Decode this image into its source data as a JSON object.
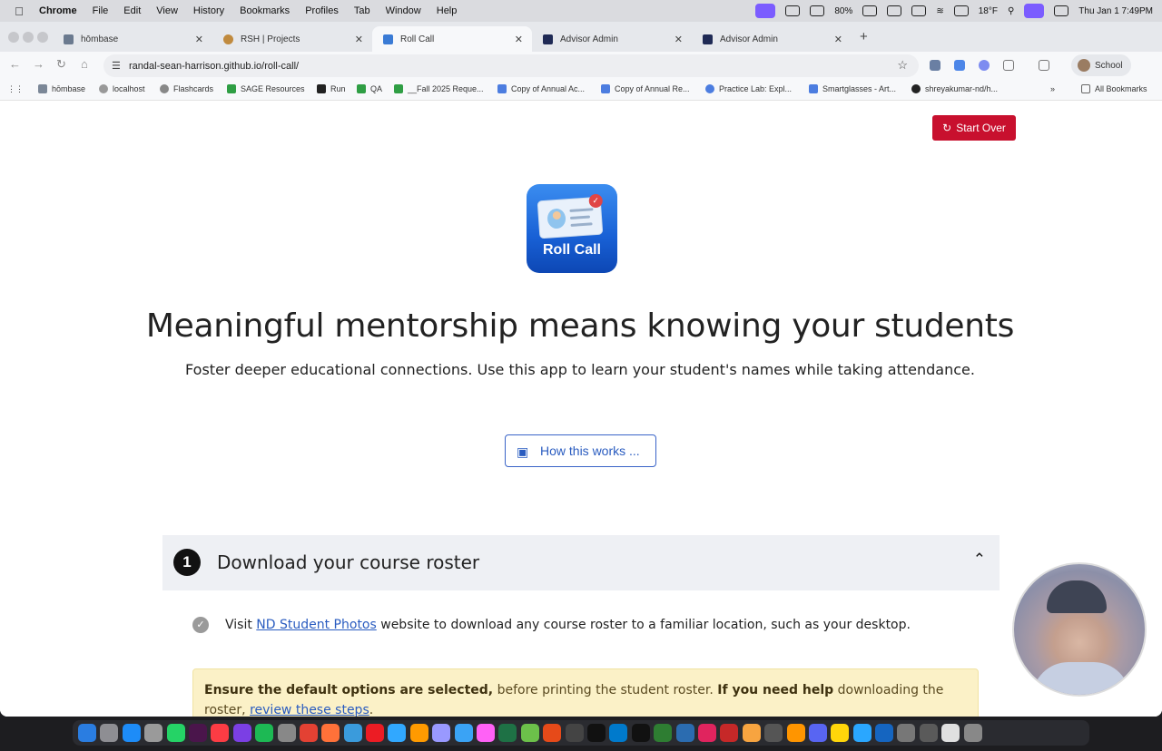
{
  "menubar": {
    "items": [
      "Chrome",
      "File",
      "Edit",
      "View",
      "History",
      "Bookmarks",
      "Profiles",
      "Tab",
      "Window",
      "Help"
    ],
    "battery": "80%",
    "weather": "18°F",
    "clock": "Thu Jan 1  7:49PM"
  },
  "tabs": [
    {
      "title": "hōmbase",
      "active": false,
      "color": "#6b7a8f"
    },
    {
      "title": "RSH | Projects",
      "active": false,
      "color": "#c08a3e"
    },
    {
      "title": "Roll Call",
      "active": true,
      "color": "#3a7bd5"
    },
    {
      "title": "Advisor Admin",
      "active": false,
      "color": "#1f2a55"
    },
    {
      "title": "Advisor Admin",
      "active": false,
      "color": "#1f2a55"
    }
  ],
  "toolbar": {
    "url": "randal-sean-harrison.github.io/roll-call/",
    "profile_label": "School"
  },
  "bookmarks": [
    {
      "label": "hōmbase",
      "color": "#7b8797"
    },
    {
      "label": "localhost",
      "color": "#999"
    },
    {
      "label": "Flashcards",
      "color": "#888"
    },
    {
      "label": "SAGE Resources",
      "color": "#2f9e44"
    },
    {
      "label": "Run",
      "color": "#222"
    },
    {
      "label": "QA",
      "color": "#2f9e44"
    },
    {
      "label": "__Fall 2025 Reque...",
      "color": "#2f9e44"
    },
    {
      "label": "Copy of Annual Ac...",
      "color": "#4c7de0"
    },
    {
      "label": "Copy of Annual Re...",
      "color": "#4c7de0"
    },
    {
      "label": "Practice Lab: Expl...",
      "color": "#4c7de0"
    },
    {
      "label": "Smartglasses - Art...",
      "color": "#4c7de0"
    },
    {
      "label": "shreyakumar-nd/h...",
      "color": "#222"
    },
    {
      "label": "All Bookmarks",
      "color": "#666"
    }
  ],
  "page": {
    "start_over_label": "Start Over",
    "logo_text": "Roll Call",
    "headline": "Meaningful mentorship means knowing your students",
    "subhead": "Foster deeper educational connections. Use this app to learn your student's names while taking attendance.",
    "how_button_label": "How this works ...",
    "accent_color": "#c8102e",
    "link_color": "#2a5cc0"
  },
  "section": {
    "number": "1",
    "title": "Download your course roster",
    "step_prefix": "Visit ",
    "step_link": "ND Student Photos",
    "step_suffix": " website to download any course roster to a familiar location, such as your desktop.",
    "alert_bold_1": "Ensure the default options are selected,",
    "alert_text_1": " before printing the student roster. ",
    "alert_bold_2": "If you need help",
    "alert_text_2": " downloading the roster, ",
    "alert_link": "review these steps",
    "alert_end": "."
  }
}
